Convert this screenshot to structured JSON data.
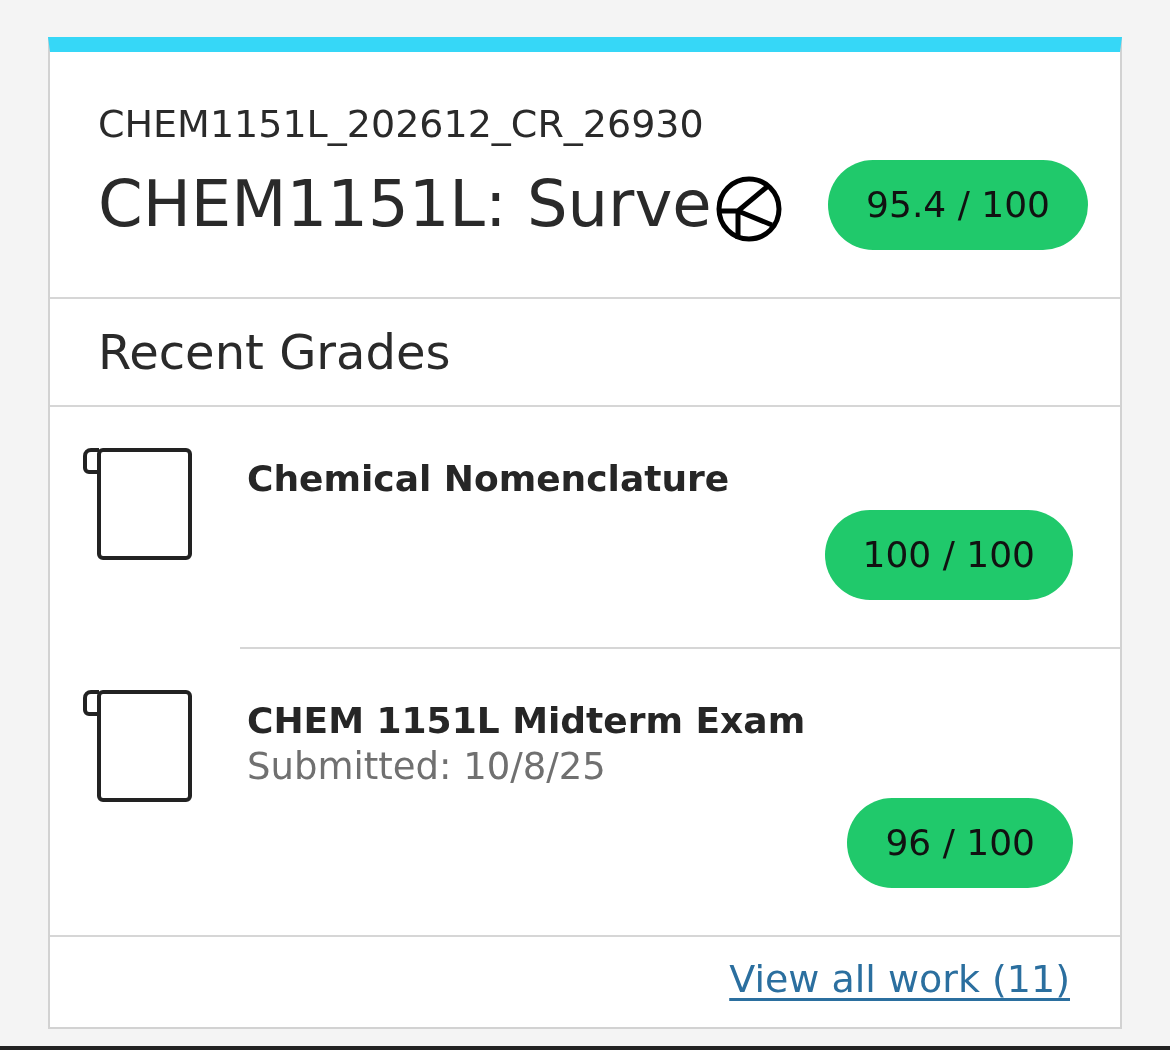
{
  "course": {
    "code": "CHEM1151L_202612_CR_26930",
    "title": "CHEM1151L: Surve",
    "score": "95.4 / 100"
  },
  "recent_grades": {
    "heading": "Recent Grades",
    "items": [
      {
        "title": "Chemical Nomenclature",
        "score": "100 / 100"
      },
      {
        "title": "CHEM 1151L Midterm Exam",
        "submitted": "Submitted: 10/8/25",
        "score": "96 / 100"
      }
    ]
  },
  "footer": {
    "link": "View all work (11)"
  }
}
